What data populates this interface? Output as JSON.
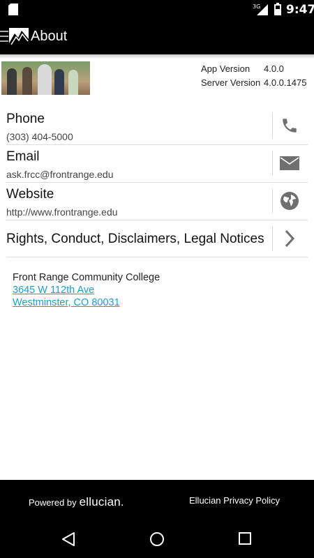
{
  "status_bar": {
    "network": "3G",
    "time": "9:47"
  },
  "app_bar": {
    "title": "About"
  },
  "versions": [
    {
      "label": "App Version",
      "value": "4.0.0"
    },
    {
      "label": "Server Version",
      "value": "4.0.0.1475"
    }
  ],
  "contacts": {
    "phone": {
      "title": "Phone",
      "value": "(303) 404-5000"
    },
    "email": {
      "title": "Email",
      "value": "ask.frcc@frontrange.edu"
    },
    "website": {
      "title": "Website",
      "value": "http://www.frontrange.edu"
    }
  },
  "legal": {
    "title": "Rights, Conduct, Disclaimers, Legal Notices"
  },
  "address": {
    "name": "Front Range Community College",
    "line1": "3645 W 112th Ave",
    "line2": "Westminster, CO 80031"
  },
  "footer": {
    "powered_by": "Powered by",
    "brand": "ellucian.",
    "privacy": "Ellucian Privacy Policy"
  },
  "colors": {
    "link": "#1a9fd0",
    "bar": "#000000",
    "icon": "#6f6f6f"
  },
  "icons": [
    "sd-card-icon",
    "signal-icon",
    "battery-icon",
    "menu-icon",
    "logo-icon",
    "phone-icon",
    "mail-icon",
    "globe-icon",
    "chevron-right-icon",
    "back-icon",
    "home-icon",
    "recents-icon"
  ]
}
